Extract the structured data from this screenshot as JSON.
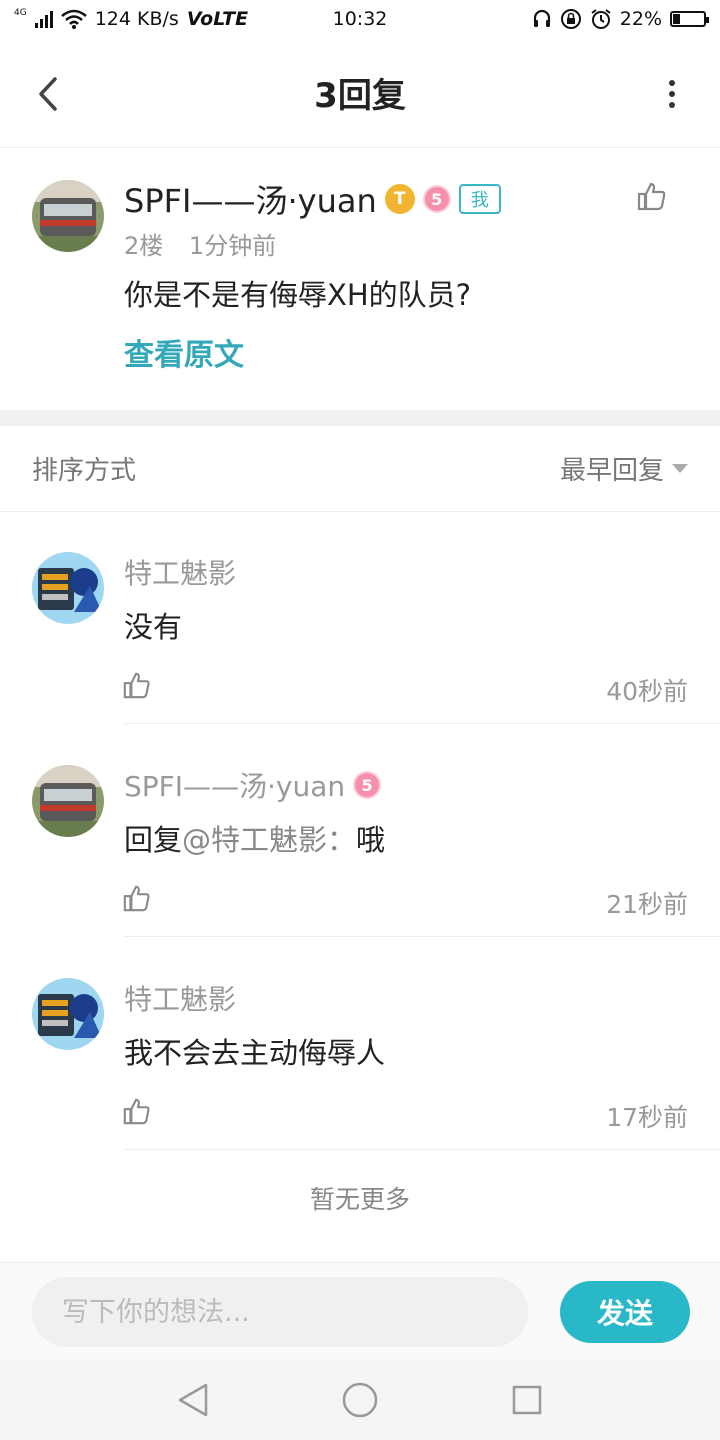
{
  "status_bar": {
    "network": "4G",
    "speed": "124 KB/s",
    "volte": "VoLTE",
    "time": "10:32",
    "battery_text": "22%",
    "battery_level": 0.22,
    "icons": [
      "signal-icon",
      "wifi-icon",
      "headset-icon",
      "rotation-lock-icon",
      "alarm-icon",
      "battery-icon"
    ]
  },
  "header": {
    "title": "3回复",
    "back_icon": "back-arrow-icon",
    "more_icon": "more-vertical-icon"
  },
  "post": {
    "username": "SPFI——汤·yuan",
    "level_badge": "T",
    "badge_number": "5",
    "me_tag": "我",
    "floor": "2楼",
    "time": "1分钟前",
    "content": "你是不是有侮辱XH的队员?",
    "view_original": "查看原文"
  },
  "sort": {
    "label": "排序方式",
    "value": "最早回复"
  },
  "replies": [
    {
      "name": "特工魅影",
      "badge": "",
      "text": "没有",
      "mention": "",
      "time": "40秒前"
    },
    {
      "name": "SPFI——汤·yuan",
      "badge": "5",
      "prefix": "回复",
      "mention": "@特工魅影：",
      "text": "哦",
      "time": "21秒前"
    },
    {
      "name": "特工魅影",
      "badge": "",
      "text": "我不会去主动侮辱人",
      "mention": "",
      "time": "17秒前"
    }
  ],
  "footer_note": "暂无更多",
  "input": {
    "placeholder": "写下你的想法...",
    "send_label": "发送"
  },
  "colors": {
    "accent": "#28b8c7",
    "link": "#32a8b8",
    "gold_badge": "#f2b531",
    "pink_badge": "#f58fac"
  }
}
